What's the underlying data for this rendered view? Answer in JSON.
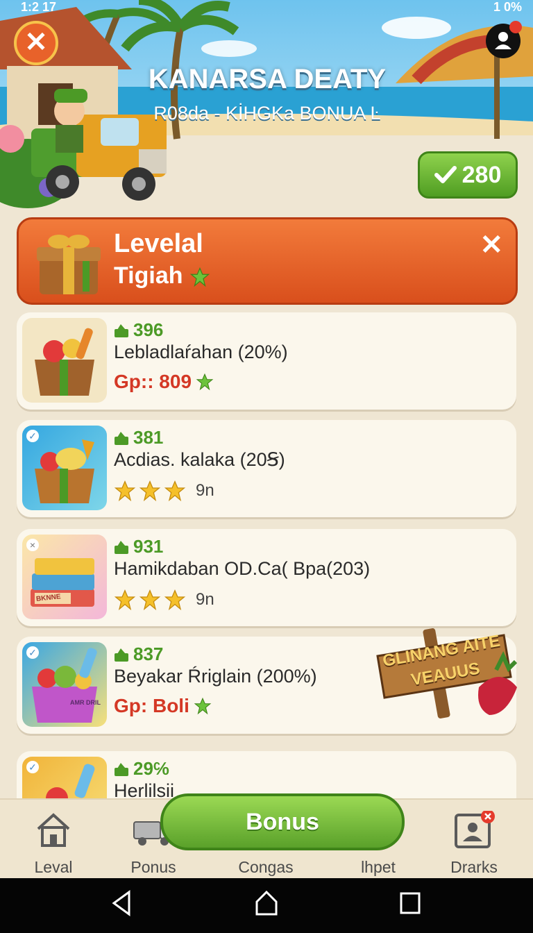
{
  "status_bar": {
    "time": "1:2 17",
    "battery": "1 0%"
  },
  "header": {
    "title": "KANARSA DEATY",
    "subtitle": "R08da - KİHGKa BONUA Ŀ",
    "coin_badge_value": "280"
  },
  "level_banner": {
    "title": "Levelal",
    "subtitle": "Tigiah"
  },
  "items": [
    {
      "count": "396",
      "name": "Lebladlaŕahan (20%)",
      "price": "Gp:: 809"
    },
    {
      "count": "381",
      "name": "Acdias. kalaka (20Ꞩ)",
      "rating_stars": 3,
      "rating_label": "9n"
    },
    {
      "count": "931",
      "name": "Hamikdaban OD.Ca( Bpa(203)",
      "rating_stars": 3,
      "rating_label": "9n",
      "thumb_label": "BKNNE"
    },
    {
      "count": "837",
      "name": "Beyakar Ŕriglain (200%)",
      "price": "Gp: Boli",
      "thumb_label": "AMR DRIL"
    },
    {
      "count": "29℅",
      "name": "Herlilsii"
    }
  ],
  "signpost": {
    "line1": "GLINANG AITE",
    "line2": "VEAUUS"
  },
  "bottom_nav": [
    {
      "label": "Leval",
      "icon": "home-icon"
    },
    {
      "label": "Ponus",
      "icon": "truck-icon"
    },
    {
      "label": "Congas",
      "icon": ""
    },
    {
      "label": "lhpet",
      "icon": ""
    },
    {
      "label": "Drarks",
      "icon": "profile-card-icon"
    }
  ],
  "bonus_button": {
    "label": "Bonus"
  },
  "colors": {
    "accent_orange": "#e8622a",
    "accent_green": "#5aa12a",
    "price_red": "#d43825",
    "count_green": "#4c9a26"
  }
}
